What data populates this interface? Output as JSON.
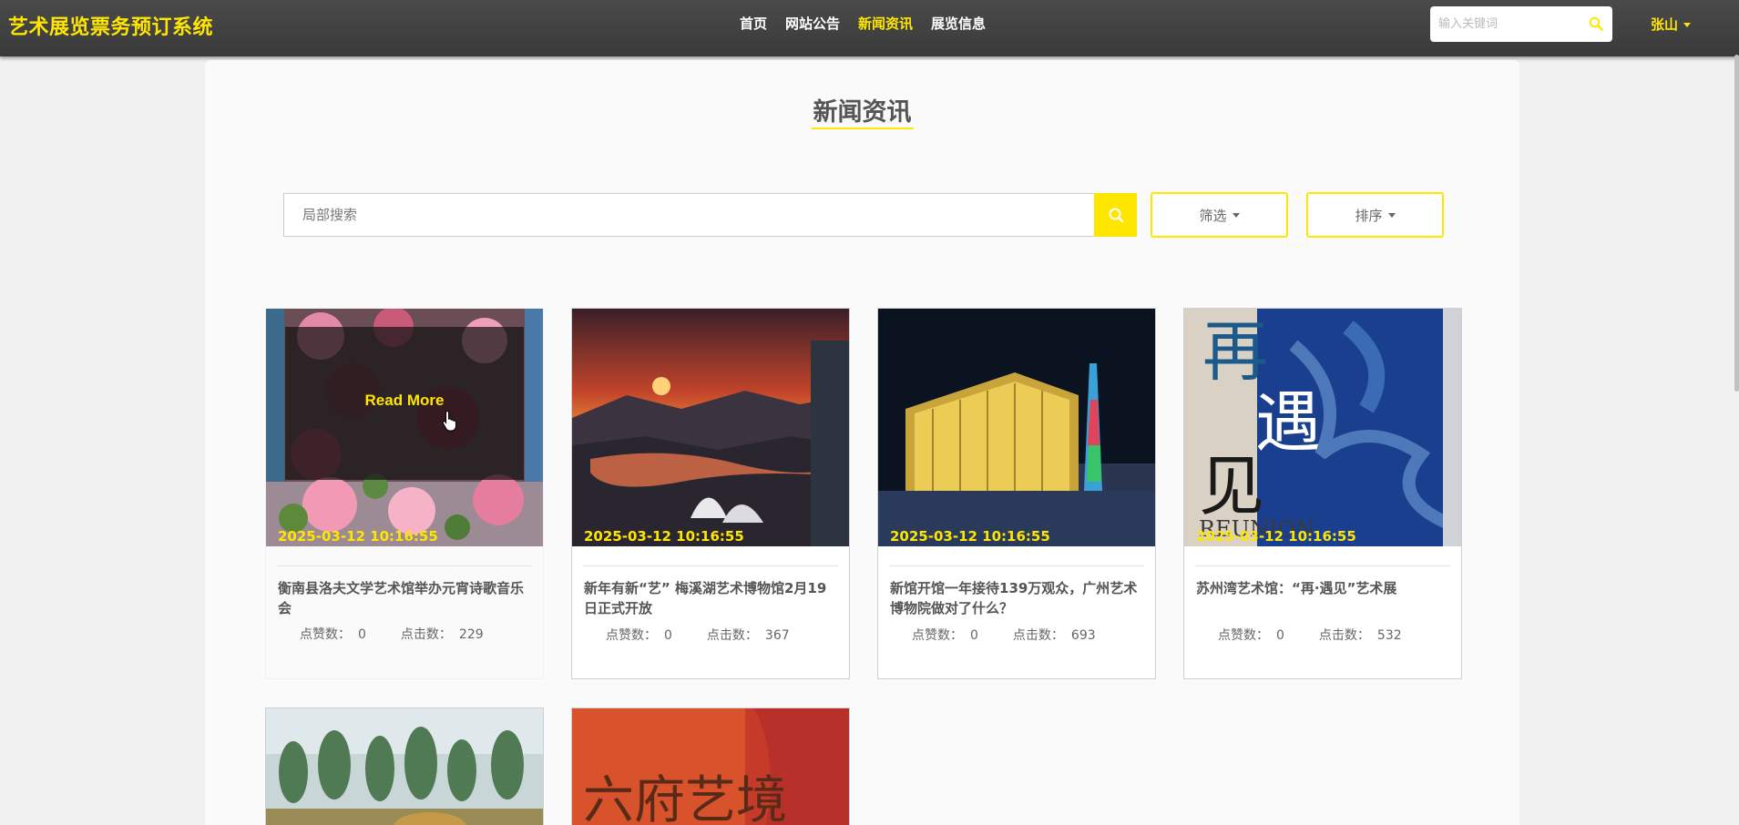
{
  "app": {
    "brand": "艺术展览票务预订系统"
  },
  "nav": {
    "items": [
      "首页",
      "网站公告",
      "新闻资讯",
      "展览信息"
    ],
    "active": "新闻资讯"
  },
  "top_search": {
    "placeholder": "输入关键词"
  },
  "user": {
    "name": "张山"
  },
  "page": {
    "title": "新闻资讯"
  },
  "search": {
    "placeholder": "局部搜索"
  },
  "filter": {
    "label": "筛选"
  },
  "sort": {
    "label": "排序"
  },
  "overlay": {
    "label": "Read More"
  },
  "news": [
    {
      "date": "2025-03-12 10:16:55",
      "title": "衡南县洛夫文学艺术馆举办元宵诗歌音乐会",
      "likes_label": "点赞数：",
      "likes": "0",
      "clicks_label": "点击数：",
      "clicks": "229"
    },
    {
      "date": "2025-03-12 10:16:55",
      "title": "新年有新“艺” 梅溪湖艺术博物馆2月19日正式开放",
      "likes_label": "点赞数：",
      "likes": "0",
      "clicks_label": "点击数：",
      "clicks": "367"
    },
    {
      "date": "2025-03-12 10:16:55",
      "title": "新馆开馆一年接待139万观众，广州艺术博物院做对了什么？",
      "likes_label": "点赞数：",
      "likes": "0",
      "clicks_label": "点击数：",
      "clicks": "693"
    },
    {
      "date": "2025-03-12 10:16:55",
      "title": "苏州湾艺术馆：“再·遇见”艺术展",
      "likes_label": "点赞数：",
      "likes": "0",
      "clicks_label": "点击数：",
      "clicks": "532"
    }
  ],
  "image_text": {
    "poster_chars": [
      "再",
      "遇",
      "见"
    ],
    "poster_en": "REUNION",
    "painting_chars": "六府艺境"
  },
  "colors": {
    "accent": "#ffe600",
    "navbar": "#3f3f3f",
    "background": "#f1f1f1"
  }
}
